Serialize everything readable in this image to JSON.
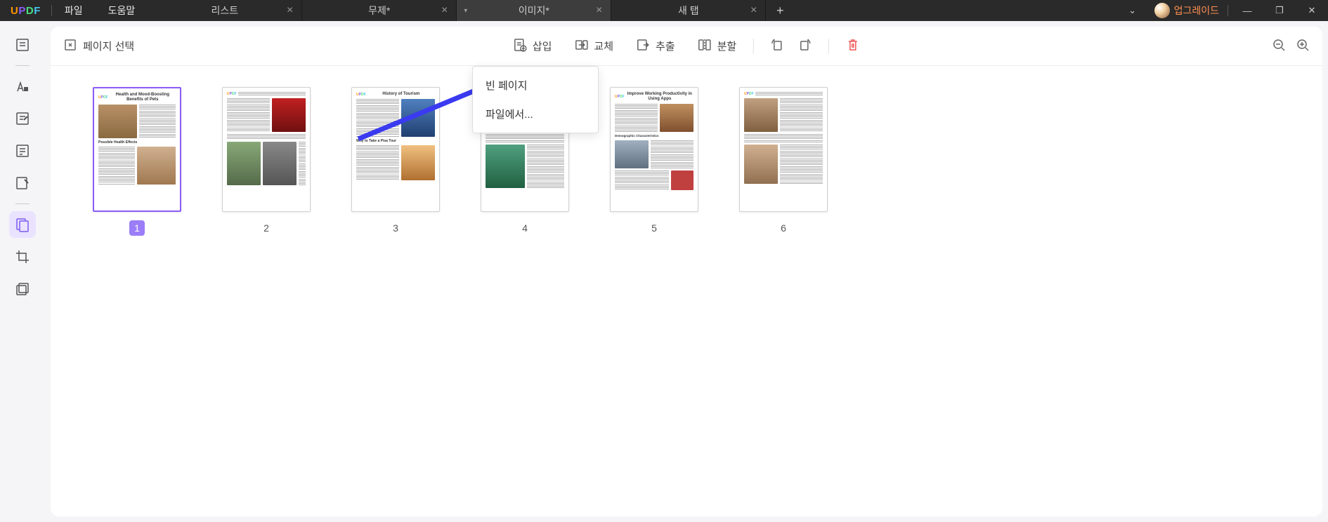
{
  "app": {
    "logo_chars": [
      "U",
      "P",
      "D",
      "F"
    ]
  },
  "menu": {
    "file": "파일",
    "help": "도움말"
  },
  "tabs": [
    {
      "label": "리스트",
      "active": false,
      "pinned": false
    },
    {
      "label": "무제*",
      "active": false,
      "pinned": false
    },
    {
      "label": "이미지*",
      "active": true,
      "pinned": true
    },
    {
      "label": "새 탭",
      "active": false,
      "pinned": false
    }
  ],
  "upgrade_label": "업그레이드",
  "toolbar": {
    "select_page": "페이지 선택",
    "insert": "삽입",
    "replace": "교체",
    "extract": "추출",
    "split": "분할"
  },
  "dropdown": {
    "blank_page": "빈 페이지",
    "from_file": "파일에서..."
  },
  "thumbnails": [
    {
      "num": "1",
      "title": "Health and Mood-Boosting Benefits of Pets",
      "subtitle": "Possible Health Effects",
      "selected": true
    },
    {
      "num": "2",
      "title": "",
      "subtitle": "",
      "selected": false
    },
    {
      "num": "3",
      "title": "History of Tourism",
      "subtitle": "Why to Take a Pisa Tour",
      "selected": false
    },
    {
      "num": "4",
      "title": "",
      "subtitle": "",
      "selected": false
    },
    {
      "num": "5",
      "title": "Improve Working Productivity in Using Apps",
      "subtitle": "Demographic Characteristics",
      "selected": false
    },
    {
      "num": "6",
      "title": "",
      "subtitle": "",
      "selected": false
    }
  ],
  "colors": {
    "accent": "#8a5cf6",
    "danger": "#f05555"
  }
}
